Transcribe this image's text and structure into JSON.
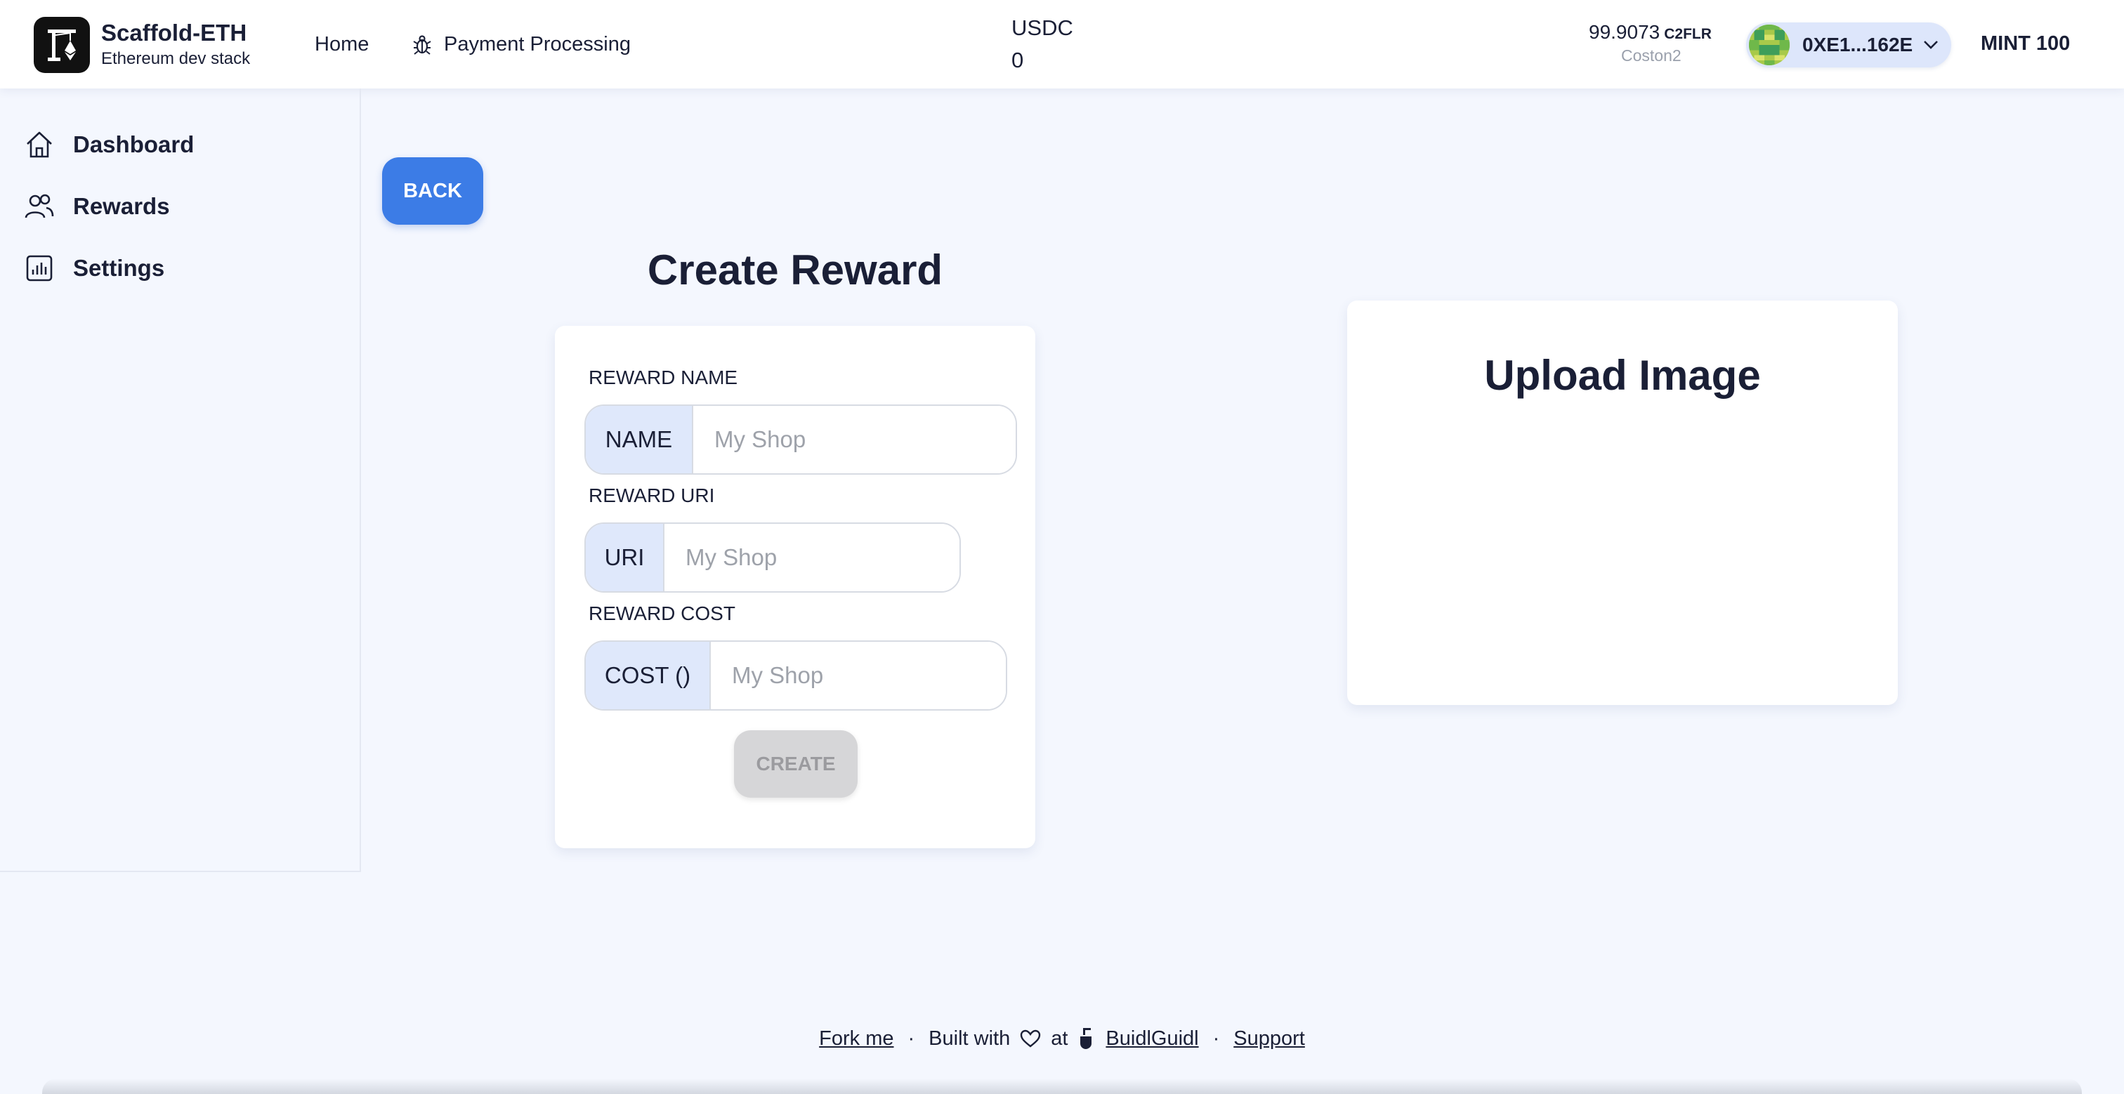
{
  "header": {
    "brand_title": "Scaffold-ETH",
    "brand_subtitle": "Ethereum dev stack",
    "nav": [
      {
        "label": "Home",
        "icon": ""
      },
      {
        "label": "Payment Processing",
        "icon": "bug-icon"
      }
    ],
    "token": {
      "label": "USDC",
      "value": "0"
    },
    "balance": {
      "amount": "99.9073",
      "symbol": "C2FLR",
      "network": "Coston2"
    },
    "account": {
      "address": "0XE1...162E",
      "icon": "chevron-down-icon"
    },
    "mint_label": "MINT 100"
  },
  "sidebar": {
    "items": [
      {
        "label": "Dashboard",
        "icon": "home-icon"
      },
      {
        "label": "Rewards",
        "icon": "users-icon"
      },
      {
        "label": "Settings",
        "icon": "bar-chart-icon"
      }
    ]
  },
  "main": {
    "back_label": "BACK",
    "title": "Create Reward",
    "form": {
      "name": {
        "label": "REWARD NAME",
        "addon": "NAME",
        "placeholder": "My Shop",
        "value": ""
      },
      "uri": {
        "label": "REWARD URI",
        "addon": "URI",
        "placeholder": "My Shop",
        "value": ""
      },
      "cost": {
        "label": "REWARD COST",
        "addon": "COST ()",
        "placeholder": "My Shop",
        "value": ""
      },
      "create_label": "CREATE"
    },
    "upload_title": "Upload Image"
  },
  "footer": {
    "fork_label": "Fork me",
    "built_with": "Built with",
    "at": "at",
    "buidlguidl_label": "BuidlGuidl",
    "support_label": "Support",
    "separator": "·"
  },
  "colors": {
    "accent": "#3c7ce6",
    "background": "#f4f7fe",
    "addon_bg": "#dfe8fb",
    "disabled_button": "#d6d6d8"
  }
}
